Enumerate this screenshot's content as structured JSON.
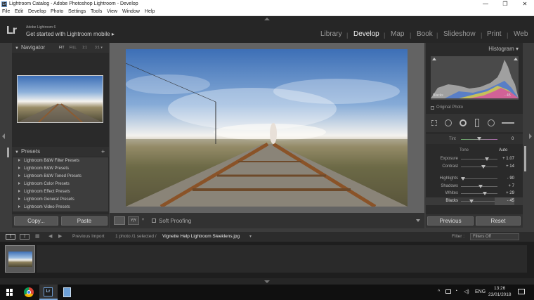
{
  "window": {
    "title": "Lightroom Catalog - Adobe Photoshop Lightroom - Develop",
    "app_icon": "Lr",
    "minimize": "—",
    "maximize": "❐",
    "close": "✕"
  },
  "menu": [
    "File",
    "Edit",
    "Develop",
    "Photo",
    "Settings",
    "Tools",
    "View",
    "Window",
    "Help"
  ],
  "identity": {
    "logo": "Lr",
    "version": "Adobe Lightroom 6",
    "mobile_text": "Get started with Lightroom mobile ▸"
  },
  "modules": [
    {
      "label": "Library",
      "active": false
    },
    {
      "label": "Develop",
      "active": true
    },
    {
      "label": "Map",
      "active": false
    },
    {
      "label": "Book",
      "active": false
    },
    {
      "label": "Slideshow",
      "active": false
    },
    {
      "label": "Print",
      "active": false
    },
    {
      "label": "Web",
      "active": false
    }
  ],
  "navigator": {
    "title": "Navigator",
    "zoom_options": [
      "FIT",
      "FILL",
      "1:1",
      "3:1 ▾"
    ]
  },
  "presets": {
    "title": "Presets",
    "add": "+",
    "items": [
      "Lightroom B&W Filter Presets",
      "Lightroom B&W Presets",
      "Lightroom B&W Toned Presets",
      "Lightroom Color Presets",
      "Lightroom Effect Presets",
      "Lightroom General Presets",
      "Lightroom Video Presets"
    ]
  },
  "left_buttons": {
    "copy": "Copy...",
    "paste": "Paste"
  },
  "toolbar": {
    "soft_proofing": "Soft Proofing",
    "view_toggle": "Y|Y",
    "dropdown": "▾"
  },
  "histogram": {
    "title": "Histogram ▾",
    "hover_label": "Blacks",
    "hover_value": "- 45",
    "original_photo": "Original Photo"
  },
  "basic": {
    "tint_label": "Tint",
    "tint_value": "0",
    "tone_label": "Tone",
    "auto_label": "Auto",
    "rows": [
      {
        "label": "Exposure",
        "value": "+ 1.07",
        "pos": 0.72
      },
      {
        "label": "Contrast",
        "value": "+ 14",
        "pos": 0.62
      },
      {
        "label": "Highlights",
        "value": "- 90",
        "pos": 0.06
      },
      {
        "label": "Shadows",
        "value": "+ 7",
        "pos": 0.54
      },
      {
        "label": "Whites",
        "value": "+ 29",
        "pos": 0.65
      },
      {
        "label": "Blacks",
        "value": "- 45",
        "pos": 0.28
      }
    ]
  },
  "right_buttons": {
    "previous": "Previous",
    "reset": "Reset"
  },
  "filmbar": {
    "view1": "1",
    "view2": "2",
    "previous_import": "Previous Import",
    "count": "1 photo /1 selected /",
    "filename": "Vignette Help Lightroom Sleeklens.jpg",
    "filename_dropdown": "▾",
    "filter_label": "Filter :",
    "filter_value": "Filters Off"
  },
  "taskbar": {
    "lang": "ENG",
    "time": "13:26",
    "date": "23/01/2018"
  },
  "colors": {
    "accent": "#4a90d9",
    "panel": "#2a2a2a",
    "center": "#636363"
  }
}
